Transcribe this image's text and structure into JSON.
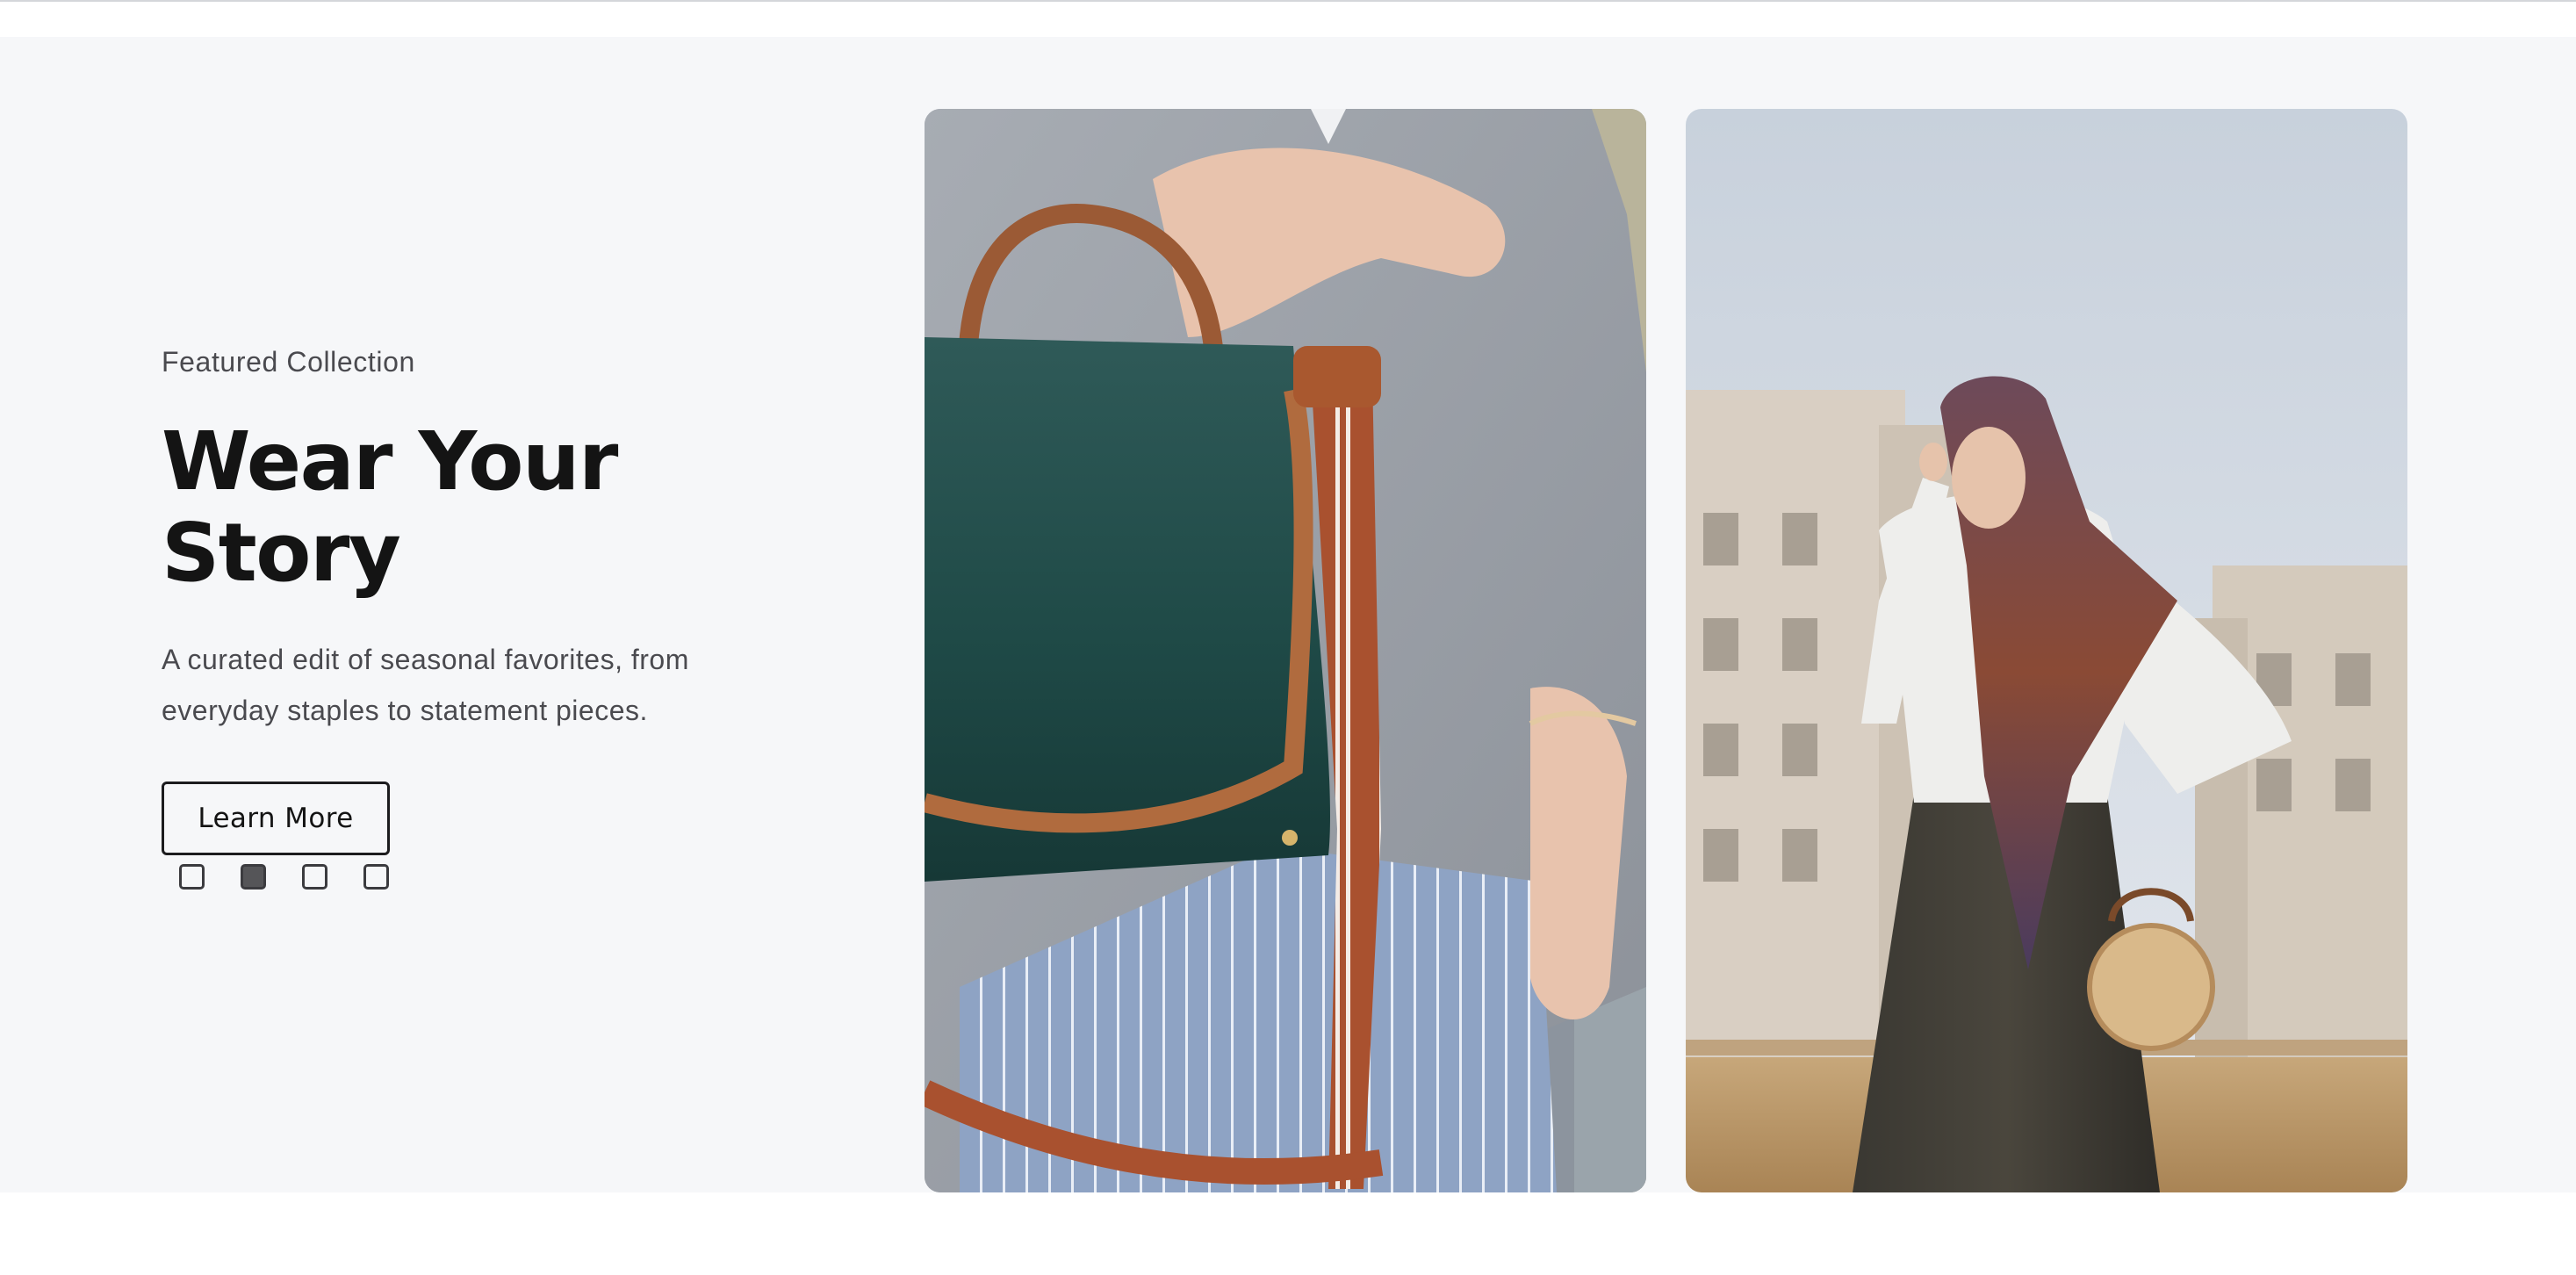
{
  "hero": {
    "eyebrow": "Featured Collection",
    "title": "Wear Your Story",
    "description": "A curated edit of seasonal favorites, from everyday staples to statement pieces.",
    "cta_label": "Learn More",
    "slides": {
      "count": 4,
      "active_index": 1
    }
  },
  "images": [
    {
      "name": "green-handbag-photo",
      "subject": "woman in grey cardigan holding a dark green leather handbag with brown strap"
    },
    {
      "name": "headscarf-woman-photo",
      "subject": "woman in floral headscarf and white top carrying a round woven bag"
    }
  ],
  "colors": {
    "background": "#f6f7f9",
    "title": "#141414",
    "body_text": "#4a4a4f",
    "button_border": "#1c1c1e",
    "dot_active": "#555558"
  }
}
